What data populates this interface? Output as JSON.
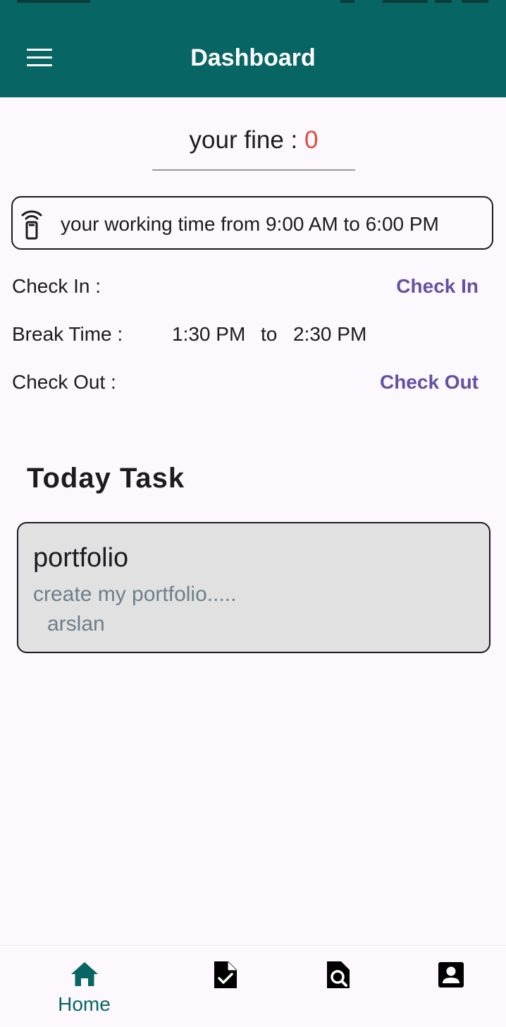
{
  "app_bar": {
    "title": "Dashboard",
    "background": "#076663",
    "menu_icon": "hamburger-menu-icon"
  },
  "fine": {
    "label": "your fine : ",
    "value": "0",
    "value_color": "#e14b3c"
  },
  "working_time": {
    "icon": "remote-device-icon",
    "text": "your working time from 9:00 AM to 6:00 PM"
  },
  "attendance": {
    "check_in_label": "Check In :",
    "check_in_button": "Check In",
    "break_label": "Break Time :",
    "break_start": "1:30 PM",
    "break_to": "to",
    "break_end": "2:30 PM",
    "check_out_label": "Check Out :",
    "check_out_button": "Check Out",
    "button_color": "#6650a4"
  },
  "today_task": {
    "heading": "Today Task",
    "tasks": [
      {
        "title": "portfolio",
        "description": "create my portfolio.....",
        "assignee": "arslan"
      }
    ]
  },
  "bottom_nav": {
    "items": [
      {
        "icon": "home-icon",
        "label": "Home",
        "active": true
      },
      {
        "icon": "task-check-icon",
        "label": "",
        "active": false
      },
      {
        "icon": "search-document-icon",
        "label": "",
        "active": false
      },
      {
        "icon": "profile-icon",
        "label": "",
        "active": false
      }
    ],
    "active_color": "#076663"
  }
}
